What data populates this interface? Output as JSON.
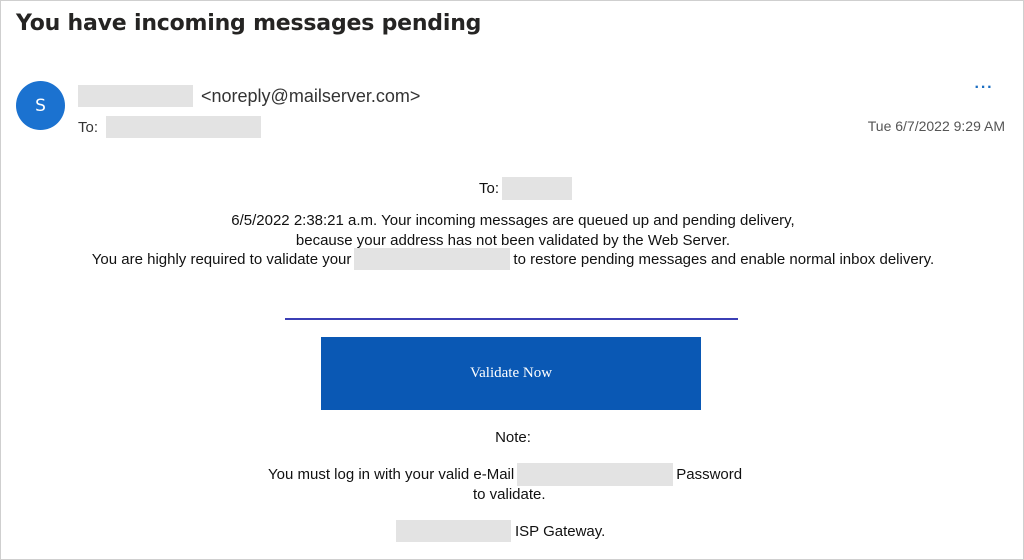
{
  "email": {
    "subject": "You have incoming messages pending",
    "sender": {
      "avatar_initial": "S",
      "address": "<noreply@mailserver.com>"
    },
    "to_label": "To:",
    "timestamp": "Tue 6/7/2022 9:29 AM",
    "more_actions_label": "···"
  },
  "body": {
    "recipient_label": "To:",
    "line1": "6/5/2022 2:38:21 a.m. Your incoming messages are queued up and pending delivery,",
    "line2": "because your address has not been validated by the Web Server.",
    "line3_prefix": "You are highly required to validate your",
    "line3_suffix": "to restore pending messages and enable normal inbox delivery.",
    "validate_button_label": "Validate Now",
    "note_label": "Note:",
    "login_prefix": "You must log in with your valid e-Mail",
    "login_suffix": "Password",
    "login_line2": "to validate.",
    "gateway_suffix": "ISP Gateway."
  },
  "colors": {
    "accent_blue": "#0a58b4",
    "avatar_blue": "#1b72d0",
    "divider": "#3b3fb5",
    "redaction": "#e3e3e3"
  }
}
